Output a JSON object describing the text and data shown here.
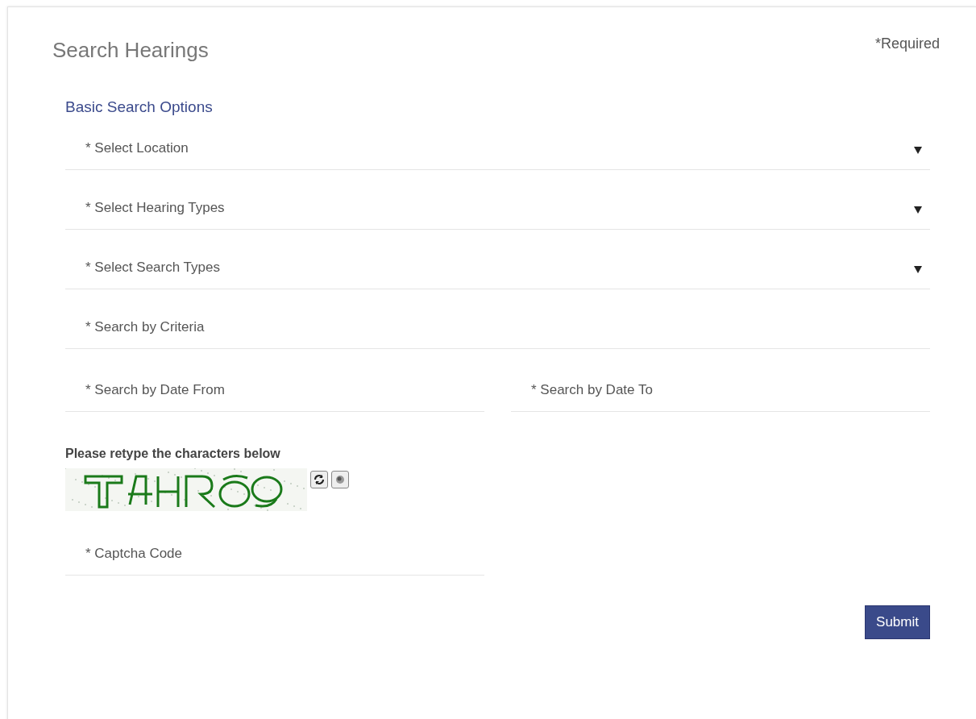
{
  "title": "Search Hearings",
  "required_note": "*Required",
  "section_title": "Basic Search Options",
  "fields": [
    {
      "kind": "select",
      "label": "* Select Location"
    },
    {
      "kind": "select",
      "label": "* Select Hearing Types"
    },
    {
      "kind": "select",
      "label": "* Select Search Types"
    },
    {
      "kind": "text",
      "placeholder": "* Search by Criteria"
    }
  ],
  "date_fields": [
    {
      "placeholder": "* Search by Date From"
    },
    {
      "placeholder": "* Search by Date To"
    }
  ],
  "captcha": {
    "prompt": "Please retype the characters below",
    "field": {
      "placeholder": "* Captcha Code"
    }
  },
  "submit": "Submit"
}
